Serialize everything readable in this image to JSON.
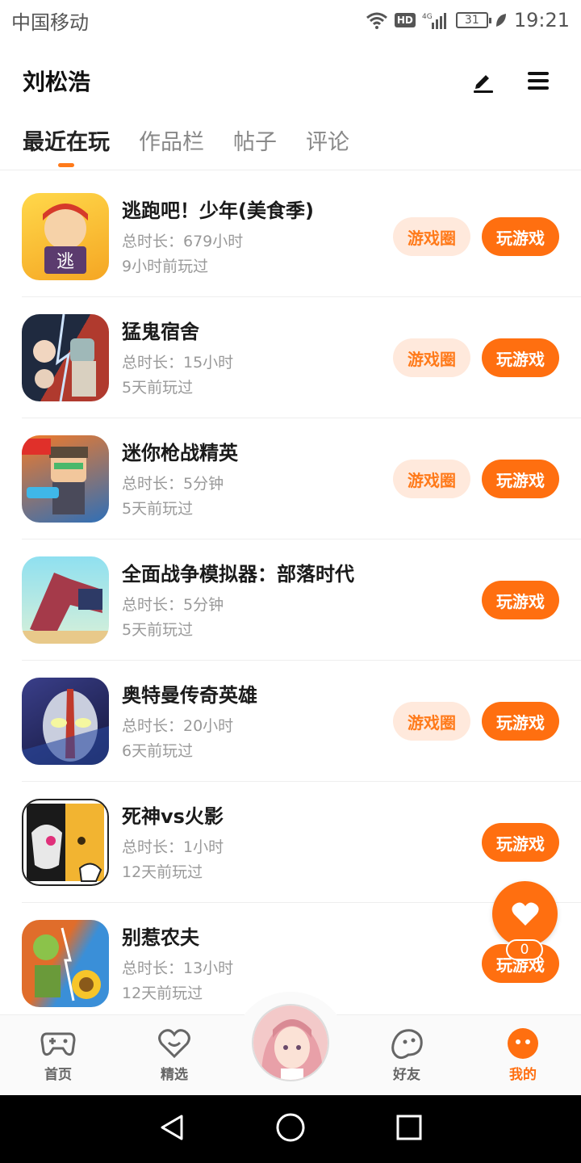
{
  "status_bar": {
    "carrier": "中国移动",
    "network": "4G",
    "hd": "HD",
    "battery": "31",
    "time": "19:21"
  },
  "header": {
    "title": "刘松浩",
    "edit_icon": "pencil-icon",
    "menu_icon": "menu-icon"
  },
  "tabs": [
    {
      "label": "最近在玩",
      "active": true
    },
    {
      "label": "作品栏",
      "active": false
    },
    {
      "label": "帖子",
      "active": false
    },
    {
      "label": "评论",
      "active": false
    }
  ],
  "games": [
    {
      "name": "逃跑吧！少年(美食季)",
      "duration": "总时长：679小时",
      "last_played": "9小时前玩过",
      "circle_label": "游戏圈",
      "play_label": "玩游戏",
      "icon_colors": [
        "#ffcf3a",
        "#e8432e"
      ]
    },
    {
      "name": "猛鬼宿舍",
      "duration": "总时长：15小时",
      "last_played": "5天前玩过",
      "circle_label": "游戏圈",
      "play_label": "玩游戏",
      "icon_colors": [
        "#1f2a3f",
        "#c0392b"
      ]
    },
    {
      "name": "迷你枪战精英",
      "duration": "总时长：5分钟",
      "last_played": "5天前玩过",
      "circle_label": "游戏圈",
      "play_label": "玩游戏",
      "icon_colors": [
        "#2f6fb7",
        "#d9a83a"
      ]
    },
    {
      "name": "全面战争模拟器：部落时代",
      "duration": "总时长：5分钟",
      "last_played": "5天前玩过",
      "circle_label": "",
      "play_label": "玩游戏",
      "icon_colors": [
        "#7fd3e8",
        "#a53a4a"
      ]
    },
    {
      "name": "奥特曼传奇英雄",
      "duration": "总时长：20小时",
      "last_played": "6天前玩过",
      "circle_label": "游戏圈",
      "play_label": "玩游戏",
      "icon_colors": [
        "#2b2f6b",
        "#b9c0d6"
      ]
    },
    {
      "name": "死神vs火影",
      "duration": "总时长：1小时",
      "last_played": "12天前玩过",
      "circle_label": "",
      "play_label": "玩游戏",
      "icon_colors": [
        "#1a1a1a",
        "#f2b431"
      ]
    },
    {
      "name": "别惹农夫",
      "duration": "总时长：13小时",
      "last_played": "12天前玩过",
      "circle_label": "",
      "play_label": "玩游戏",
      "icon_colors": [
        "#3a8fd8",
        "#e06d2b"
      ]
    }
  ],
  "floating": {
    "icon": "heart-icon",
    "count": "0"
  },
  "bottom_nav": [
    {
      "label": "首页",
      "icon": "gamepad-icon",
      "active": false
    },
    {
      "label": "精选",
      "icon": "heart-outline-icon",
      "active": false
    },
    {
      "label": "",
      "icon": "avatar",
      "active": false
    },
    {
      "label": "好友",
      "icon": "friend-icon",
      "active": false
    },
    {
      "label": "我的",
      "icon": "me-icon",
      "active": true
    }
  ],
  "colors": {
    "accent": "#ff6f10",
    "accent_light": "#ffe9dc"
  }
}
